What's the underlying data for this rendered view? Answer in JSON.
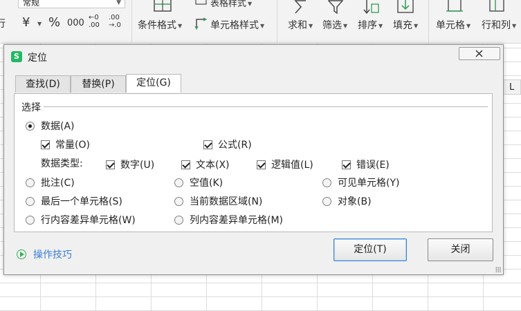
{
  "ribbon": {
    "number_format": "常规",
    "partial_left_text": "行",
    "currency_symbol": "¥",
    "percent_symbol": "%",
    "thousands_symbol": "000",
    "increase_decimal": "←0 .00",
    "decrease_decimal": ".00 →.0",
    "cond_format_label": "条件格式",
    "table_style_label": "表格样式",
    "cell_style_label": "单元格样式",
    "sum_label": "求和",
    "filter_label": "筛选",
    "sort_label": "排序",
    "fill_label": "填充",
    "cell_label": "单元格",
    "rowcol_label": "行和列"
  },
  "sheet": {
    "col_header_partial": "L"
  },
  "dialog": {
    "title": "定位",
    "tabs": [
      {
        "label": "查找(D)"
      },
      {
        "label": "替换(P)"
      },
      {
        "label": "定位(G)",
        "active": true
      }
    ],
    "group_label": "选择",
    "options": {
      "data": {
        "label": "数据(A)",
        "selected": true
      },
      "constants": {
        "label": "常量(O)",
        "checked": true
      },
      "formulas": {
        "label": "公式(R)",
        "checked": true
      },
      "data_type_label": "数据类型:",
      "numbers": {
        "label": "数字(U)",
        "checked": true
      },
      "text": {
        "label": "文本(X)",
        "checked": true
      },
      "logicals": {
        "label": "逻辑值(L)",
        "checked": true
      },
      "errors": {
        "label": "错误(E)",
        "checked": true
      },
      "comments": {
        "label": "批注(C)"
      },
      "blanks": {
        "label": "空值(K)"
      },
      "visible_cells": {
        "label": "可见单元格(Y)"
      },
      "last_cell": {
        "label": "最后一个单元格(S)"
      },
      "current_region": {
        "label": "当前数据区域(N)"
      },
      "objects": {
        "label": "对象(B)"
      },
      "row_differences": {
        "label": "行内容差异单元格(W)"
      },
      "column_differences": {
        "label": "列内容差异单元格(M)"
      }
    },
    "tips_label": "操作技巧",
    "ok_button": "定位(T)",
    "close_button": "关闭"
  },
  "colors": {
    "accent": "#3b86d6",
    "link": "#3a7fd6",
    "app_icon": "#25b864"
  }
}
